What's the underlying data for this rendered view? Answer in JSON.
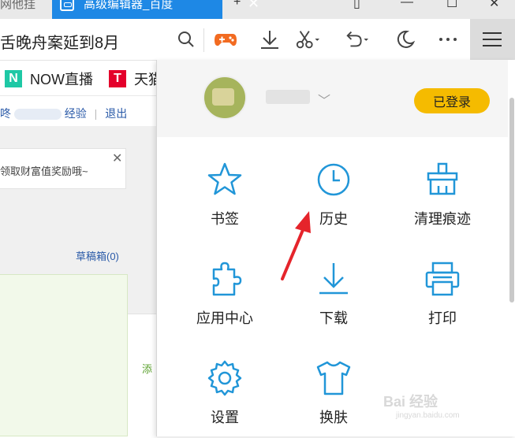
{
  "tabs": {
    "left_tab_fragment": "网他挂",
    "active_tab_title": "高级编辑器_百度",
    "new_tab": "+"
  },
  "address": {
    "text": "舌晚舟案延到8月"
  },
  "toolbar": {
    "icons": [
      "search-icon",
      "game-controller-icon",
      "download-icon",
      "scissors-icon",
      "undo-icon",
      "moon-icon",
      "more-icon",
      "menu-icon"
    ]
  },
  "bookmarks": [
    {
      "label": "NOW直播",
      "logo": "N",
      "color": "#1ec8a5"
    },
    {
      "label": "天猫",
      "logo": "T",
      "color": "#e4002b"
    }
  ],
  "page": {
    "user_links_fragment": "咚",
    "experience_link": "经验",
    "logout_link": "退出",
    "notice_text": "领取财富值奖励哦~",
    "draft_link": "草稿箱(0)",
    "add_text": "添"
  },
  "panel": {
    "login_status": "已登录",
    "items": [
      {
        "label": "书签",
        "icon": "star-icon"
      },
      {
        "label": "历史",
        "icon": "clock-icon"
      },
      {
        "label": "清理痕迹",
        "icon": "broom-icon"
      },
      {
        "label": "应用中心",
        "icon": "puzzle-icon"
      },
      {
        "label": "下载",
        "icon": "download-icon"
      },
      {
        "label": "打印",
        "icon": "printer-icon"
      },
      {
        "label": "设置",
        "icon": "gear-icon"
      },
      {
        "label": "换肤",
        "icon": "shirt-icon"
      }
    ]
  },
  "watermark": {
    "text": "Bai 经验",
    "url": "jingyan.baidu.com"
  },
  "colors": {
    "accent": "#1e88e5",
    "icon_blue": "#2196d8",
    "badge": "#f5bb00",
    "arrow": "#e5242b"
  }
}
